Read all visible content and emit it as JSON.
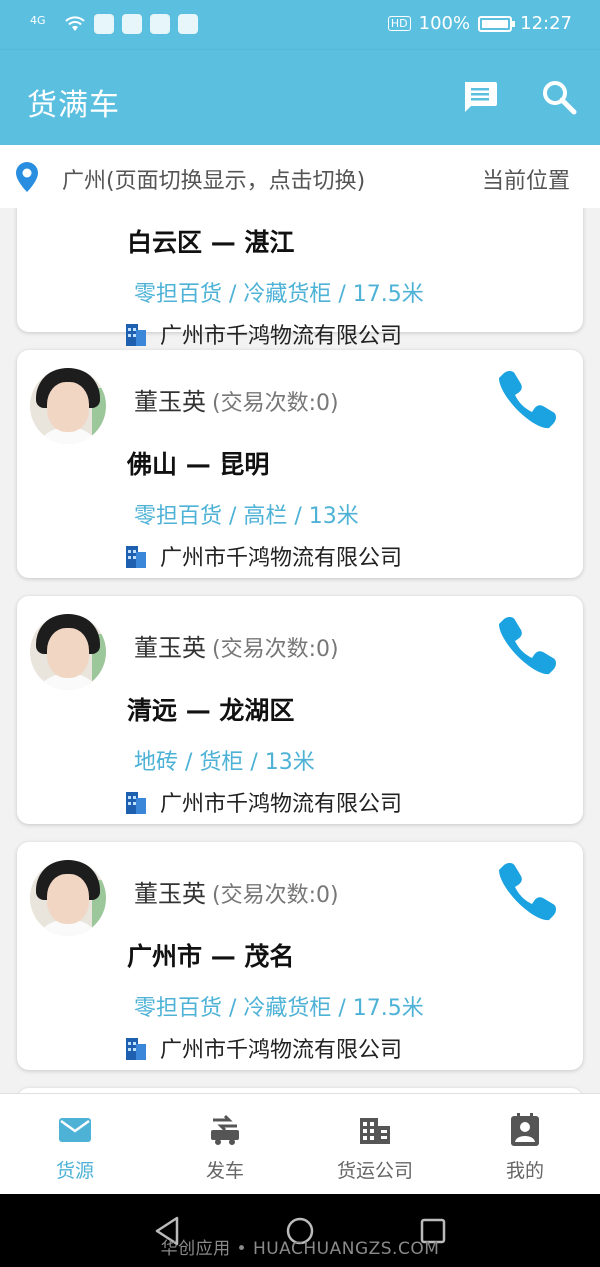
{
  "statusbar": {
    "network": "4G",
    "hd": "HD",
    "battery": "100%",
    "time": "12:27"
  },
  "appbar": {
    "title": "货满车"
  },
  "location": {
    "city": "广州(页面切换显示，点击切换)",
    "current": "当前位置"
  },
  "cards": [
    {
      "name": "",
      "trades": "",
      "route": "白云区 — 湛江",
      "cargo": "零担百货 / 冷藏货柜 / 17.5米",
      "company": "广州市千鸿物流有限公司"
    },
    {
      "name": "董玉英",
      "trades": "(交易次数:0)",
      "route": "佛山 — 昆明",
      "cargo": "零担百货 / 高栏 / 13米",
      "company": "广州市千鸿物流有限公司"
    },
    {
      "name": "董玉英",
      "trades": "(交易次数:0)",
      "route": "清远 — 龙湖区",
      "cargo": "地砖 / 货柜 / 13米",
      "company": "广州市千鸿物流有限公司"
    },
    {
      "name": "董玉英",
      "trades": "(交易次数:0)",
      "route": "广州市 — 茂名",
      "cargo": "零担百货 / 冷藏货柜 / 17.5米",
      "company": "广州市千鸿物流有限公司"
    }
  ],
  "nav": {
    "tabs": [
      {
        "label": "货源",
        "icon": "mail-icon",
        "active": true
      },
      {
        "label": "发车",
        "icon": "truck-icon",
        "active": false
      },
      {
        "label": "货运公司",
        "icon": "building-icon",
        "active": false
      },
      {
        "label": "我的",
        "icon": "profile-icon",
        "active": false
      }
    ]
  },
  "watermark": "华创应用 • HUACHUANGZS.COM",
  "colors": {
    "primary": "#5bbfe0",
    "accent": "#4db2d6",
    "phone": "#1aa3e0"
  }
}
